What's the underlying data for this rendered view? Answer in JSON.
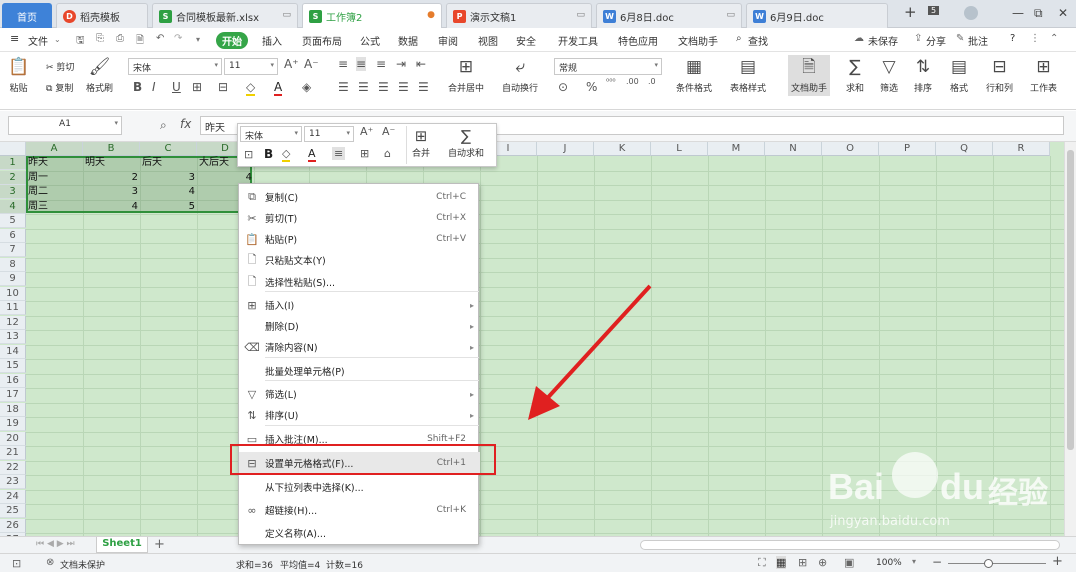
{
  "tabs": [
    {
      "label": "首页",
      "icon": "",
      "icon_color": "#3e82d8",
      "status": ""
    },
    {
      "label": "稻壳模板",
      "icon": "D",
      "icon_color": "#e8472b",
      "status": ""
    },
    {
      "label": "合同模板最新.xlsx",
      "icon": "S",
      "icon_color": "#2ea043",
      "status": "▭"
    },
    {
      "label": "工作簿2",
      "icon": "S",
      "icon_color": "#2ea043",
      "status": "●"
    },
    {
      "label": "演示文稿1",
      "icon": "P",
      "icon_color": "#e8472b",
      "status": "▭"
    },
    {
      "label": "6月8日.doc",
      "icon": "W",
      "icon_color": "#3e7fd6",
      "status": "▭"
    },
    {
      "label": "6月9日.doc",
      "icon": "W",
      "icon_color": "#3e7fd6",
      "status": ""
    }
  ],
  "tab_controls": {
    "new": "+",
    "count": "5",
    "close": "✕",
    "min": "—",
    "restore": "⧉"
  },
  "menu": {
    "file": "文件",
    "items": [
      "开始",
      "插入",
      "页面布局",
      "公式",
      "数据",
      "审阅",
      "视图",
      "安全",
      "开发工具",
      "特色应用",
      "文档助手"
    ],
    "search": "查找",
    "unsaved": "未保存",
    "share": "分享",
    "comment": "批注",
    "help": "?"
  },
  "ribbon": {
    "paste": "粘贴",
    "cut": "剪切",
    "copy": "复制",
    "format_painter": "格式刷",
    "font_name": "宋体",
    "font_size": "11",
    "merge": "合并居中",
    "wrap": "自动换行",
    "number_format": "常规",
    "cond_format": "条件格式",
    "table_style": "表格样式",
    "doc_helper": "文档助手",
    "sum": "求和",
    "filter": "筛选",
    "sort": "排序",
    "format": "格式",
    "rowcol": "行和列",
    "sheet": "工作表",
    "bold": "B",
    "italic": "I",
    "underline": "U",
    "percent": "%",
    "comma": ","
  },
  "formula_bar": {
    "cell_ref": "A1",
    "fx": "fx",
    "content": "昨天"
  },
  "columns": [
    "A",
    "B",
    "C",
    "D",
    "E",
    "F",
    "G",
    "H",
    "I",
    "J",
    "K",
    "L",
    "M",
    "N",
    "O",
    "P",
    "Q",
    "R"
  ],
  "rows": [
    "1",
    "2",
    "3",
    "4",
    "5",
    "6",
    "7",
    "8",
    "9",
    "10",
    "11",
    "12",
    "13",
    "14",
    "15",
    "16",
    "17",
    "18",
    "19",
    "20",
    "21",
    "22",
    "23",
    "24",
    "25",
    "26",
    "27"
  ],
  "cells": [
    [
      "昨天",
      "明天",
      "后天",
      "大后天"
    ],
    [
      "周一",
      "2",
      "3",
      "4"
    ],
    [
      "周二",
      "3",
      "4",
      ""
    ],
    [
      "周三",
      "4",
      "5",
      ""
    ]
  ],
  "mini_toolbar": {
    "font": "宋体",
    "size": "11",
    "merge": "合并",
    "autosum": "自动求和",
    "bold": "B"
  },
  "context_menu": [
    {
      "label": "复制(C)",
      "shortcut": "Ctrl+C",
      "icon": "copy-icon",
      "glyph": "⧉",
      "arrow": false
    },
    {
      "label": "剪切(T)",
      "shortcut": "Ctrl+X",
      "icon": "scissors-icon",
      "glyph": "✂",
      "arrow": false
    },
    {
      "label": "粘贴(P)",
      "shortcut": "Ctrl+V",
      "icon": "paste-icon",
      "glyph": "📋",
      "arrow": false
    },
    {
      "label": "只粘贴文本(Y)",
      "shortcut": "",
      "icon": "paste-text-icon",
      "glyph": "🗋",
      "arrow": false
    },
    {
      "label": "选择性粘贴(S)...",
      "shortcut": "",
      "icon": "paste-special-icon",
      "glyph": "🗋",
      "arrow": false
    },
    {
      "label": "插入(I)",
      "shortcut": "",
      "icon": "insert-icon",
      "glyph": "⊞",
      "arrow": true
    },
    {
      "label": "删除(D)",
      "shortcut": "",
      "icon": "",
      "glyph": "",
      "arrow": true
    },
    {
      "label": "清除内容(N)",
      "shortcut": "",
      "icon": "eraser-icon",
      "glyph": "⌫",
      "arrow": true
    },
    {
      "label": "批量处理单元格(P)",
      "shortcut": "",
      "icon": "",
      "glyph": "",
      "arrow": false
    },
    {
      "label": "筛选(L)",
      "shortcut": "",
      "icon": "filter-icon",
      "glyph": "▽",
      "arrow": true
    },
    {
      "label": "排序(U)",
      "shortcut": "",
      "icon": "sort-icon",
      "glyph": "⇅",
      "arrow": true
    },
    {
      "label": "插入批注(M)...",
      "shortcut": "Shift+F2",
      "icon": "comment-icon",
      "glyph": "▭",
      "arrow": false
    },
    {
      "label": "设置单元格格式(F)...",
      "shortcut": "Ctrl+1",
      "icon": "format-cells-icon",
      "glyph": "⊟",
      "arrow": false
    },
    {
      "label": "从下拉列表中选择(K)...",
      "shortcut": "",
      "icon": "",
      "glyph": "",
      "arrow": false
    },
    {
      "label": "超链接(H)...",
      "shortcut": "Ctrl+K",
      "icon": "link-icon",
      "glyph": "∞",
      "arrow": false
    },
    {
      "label": "定义名称(A)...",
      "shortcut": "",
      "icon": "",
      "glyph": "",
      "arrow": false
    }
  ],
  "sheet_tab": "Sheet1",
  "status": {
    "protect": "文档未保护",
    "sum": "求和=36",
    "avg": "平均值=4",
    "count": "计数=16",
    "zoom": "100%"
  },
  "watermark": {
    "brand": "Bai",
    "brand2": "du",
    "text": "经验",
    "url": "jingyan.baidu.com"
  },
  "colors": {
    "accent_green": "#35a548",
    "selection": "#2f8f3a",
    "grid_bg": "#cfe8cc",
    "red": "#e02020"
  }
}
